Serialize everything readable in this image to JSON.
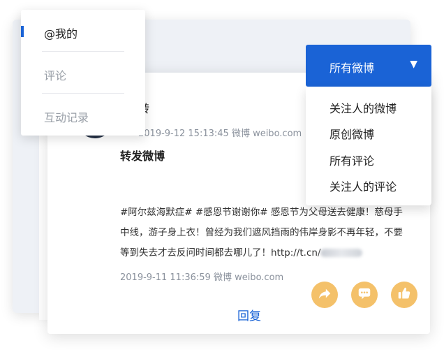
{
  "background_card": {},
  "post": {
    "username_fragment": "转",
    "date_time": "2019-9-12 15:13:45",
    "source": "微博 weibo.com",
    "title": "转发微博",
    "quoted_text": "#阿尔兹海默症# #感恩节谢谢你# 感恩节为父母送去健康！慈母手中线，游子身上衣！曾经为我们遮风挡雨的伟岸身影不再年轻，不要等到失去才去反问时间都去哪儿了！http://t.cn/",
    "quoted_date_time": "2019-9-11 11:36:59",
    "quoted_source": "微博 weibo.com",
    "reply_label": "回复"
  },
  "actions": [
    {
      "icon": "share-icon"
    },
    {
      "icon": "comment-icon"
    },
    {
      "icon": "like-icon"
    }
  ],
  "left_menu": {
    "items": [
      {
        "label": "@我的",
        "active": true
      },
      {
        "label": "评论",
        "active": false
      },
      {
        "label": "互动记录",
        "active": false
      }
    ]
  },
  "filter": {
    "selected": "所有微博",
    "caret": "▼",
    "options": [
      "关注人的微博",
      "原创微博",
      "所有评论",
      "关注人的评论"
    ]
  },
  "colors": {
    "accent": "#1a63d6",
    "action_button": "#f4c16a",
    "muted_text": "#8a919c"
  }
}
